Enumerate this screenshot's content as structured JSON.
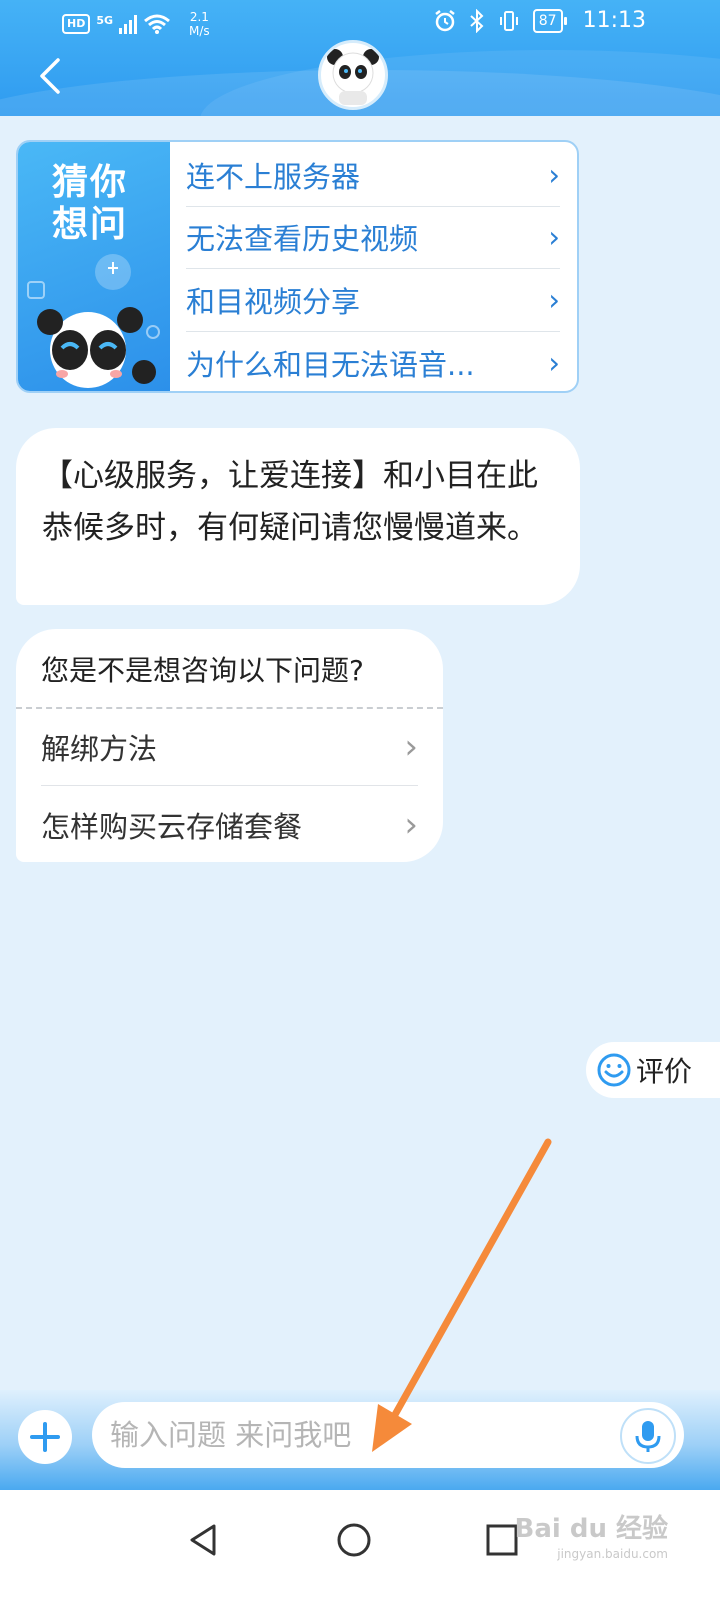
{
  "status_bar": {
    "hd": "HD",
    "network": "5G",
    "speed_value": "2.1",
    "speed_unit": "M/s",
    "battery": "87",
    "time": "11:13"
  },
  "header": {
    "back_icon": "chevron-left-icon",
    "avatar_icon": "panda-avatar-icon"
  },
  "guess": {
    "title": "猜你想问",
    "items": [
      {
        "label": "连不上服务器"
      },
      {
        "label": "无法查看历史视频"
      },
      {
        "label": "和目视频分享"
      },
      {
        "label": "为什么和目无法语音..."
      }
    ]
  },
  "greeting": {
    "text": "【心级服务，让爱连接】和小目在此恭候多时，有何疑问请您慢慢道来。"
  },
  "suggest": {
    "question": "您是不是想咨询以下问题?",
    "items": [
      {
        "label": "解绑方法"
      },
      {
        "label": "怎样购买云存储套餐"
      }
    ]
  },
  "rate": {
    "label": "评价",
    "icon": "smiley-icon"
  },
  "input": {
    "placeholder": "输入问题 来问我吧",
    "value": ""
  },
  "watermark": {
    "brand": "Bai du 经验",
    "url": "jingyan.baidu.com"
  },
  "colors": {
    "header_blue": "#2f9bf0",
    "link_blue": "#2a7fd4",
    "page_bg": "#e3f1fc",
    "annotation_orange": "#f58a3a"
  }
}
